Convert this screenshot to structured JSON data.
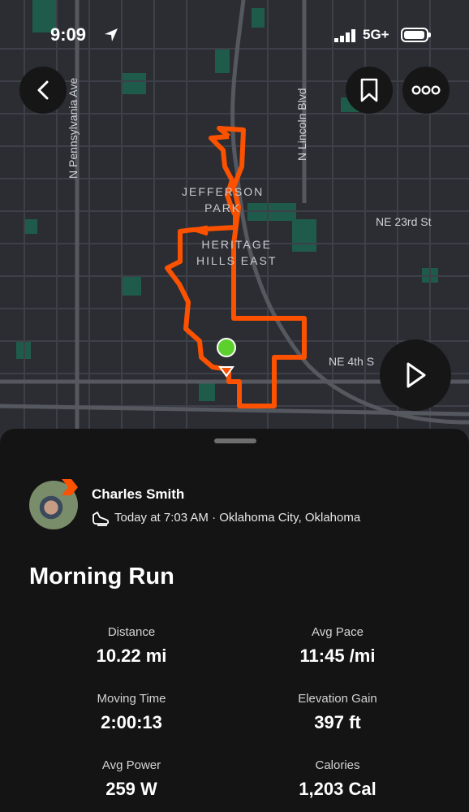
{
  "status_bar": {
    "time": "9:09",
    "network": "5G+",
    "battery_level": 0.95
  },
  "map": {
    "streets": {
      "pennsylvania": "N Pennsylvania Ave",
      "lincoln": "N Lincoln Blvd",
      "ne23": "NE 23rd St",
      "ne4": "NE 4th S"
    },
    "areas": {
      "jefferson": "JEFFERSON\nPARK",
      "heritage": "HERITAGE\nHILLS EAST"
    },
    "route_color": "#fc5200",
    "start_color": "#5cd12e"
  },
  "buttons": {
    "back": "back-icon",
    "bookmark": "bookmark-icon",
    "more": "more-icon",
    "play": "play-icon"
  },
  "activity": {
    "athlete": "Charles Smith",
    "meta": "Today at 7:03 AM · Oklahoma City, Oklahoma",
    "title": "Morning Run",
    "stats": [
      {
        "label": "Distance",
        "value": "10.22 mi"
      },
      {
        "label": "Avg Pace",
        "value": "11:45 /mi"
      },
      {
        "label": "Moving Time",
        "value": "2:00:13"
      },
      {
        "label": "Elevation Gain",
        "value": "397 ft"
      },
      {
        "label": "Avg Power",
        "value": "259 W"
      },
      {
        "label": "Calories",
        "value": "1,203 Cal"
      }
    ]
  }
}
